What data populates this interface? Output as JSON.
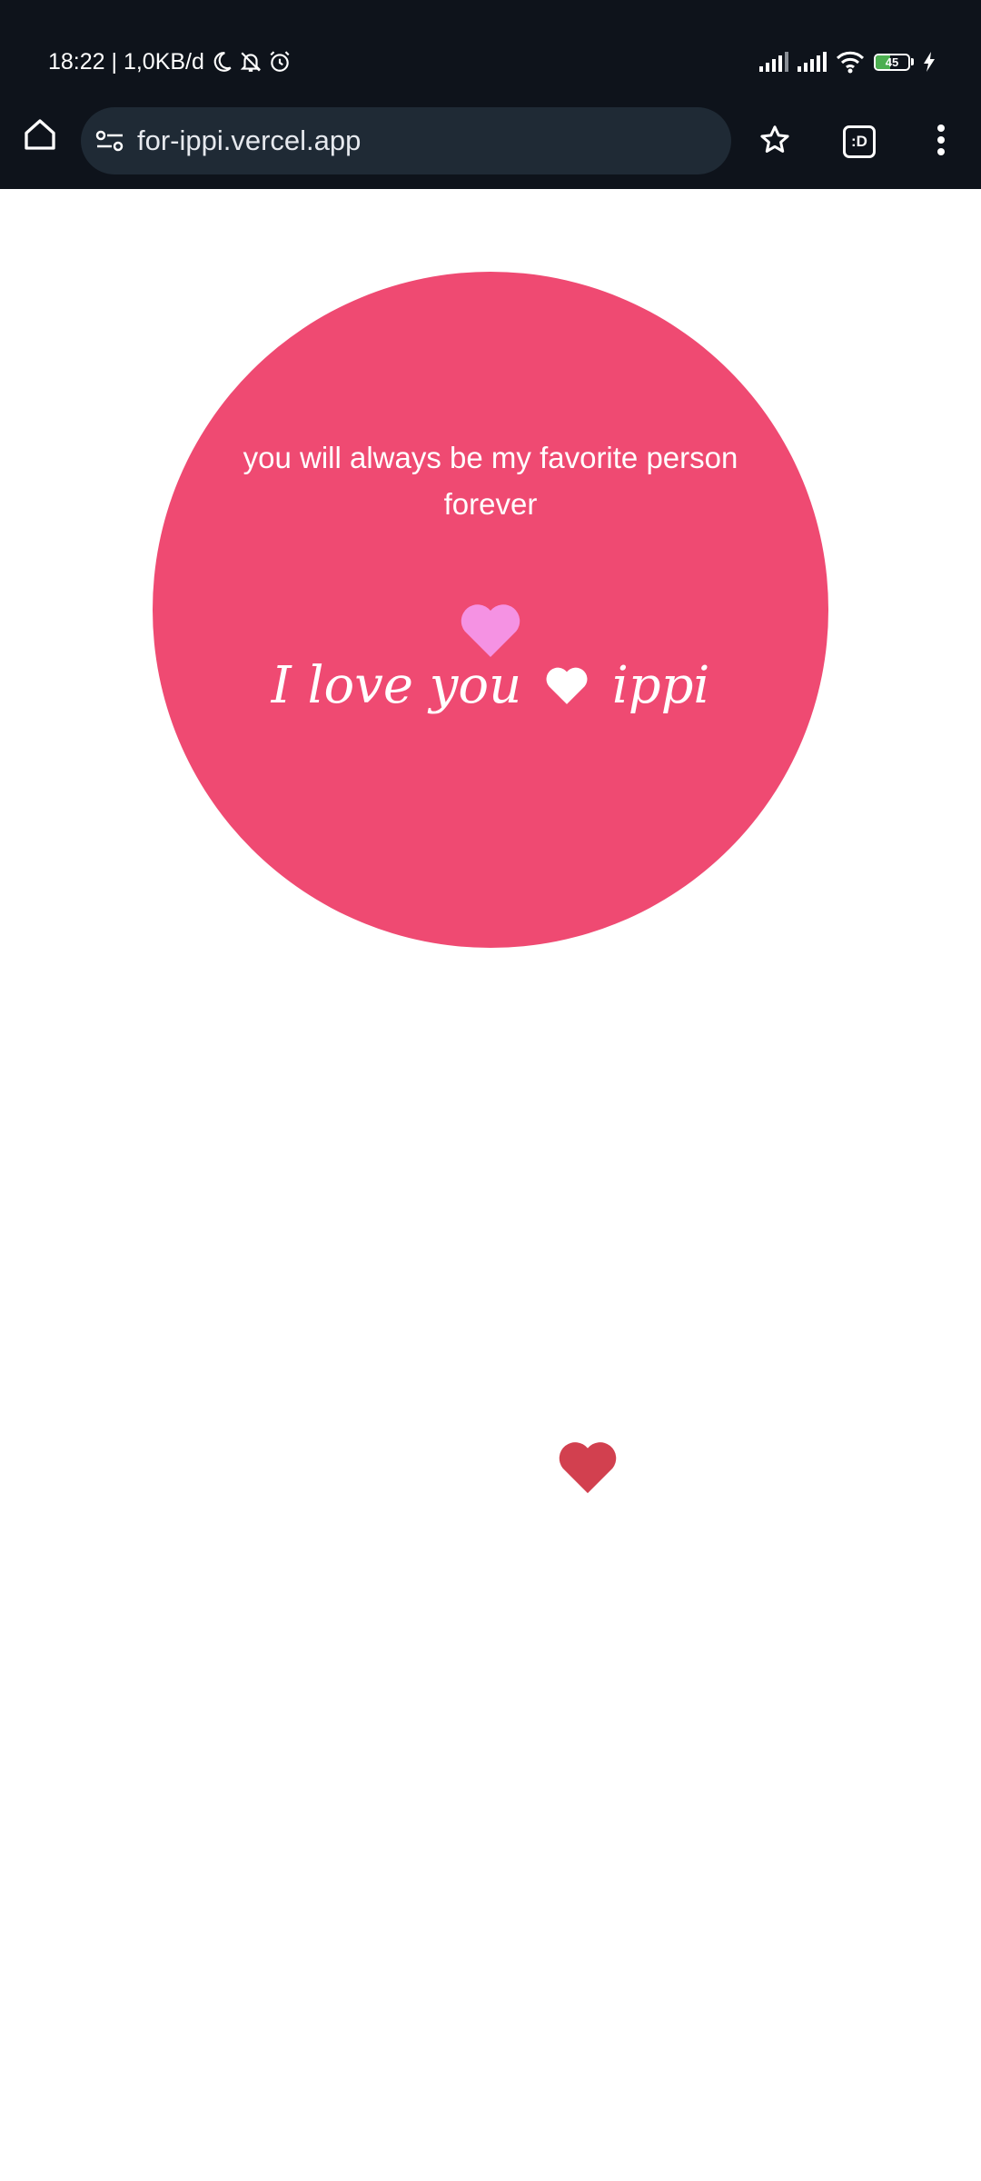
{
  "status_bar": {
    "time_speed": "18:22 | 1,0KB/d",
    "battery_level": "45",
    "battery_fraction": 0.45,
    "icons": [
      "moon-icon",
      "bell-off-icon",
      "alarm-icon",
      "signal-icon",
      "signal-icon",
      "wifi-icon",
      "battery-icon",
      "charging-icon"
    ]
  },
  "toolbar": {
    "url": "for-ippi.vercel.app",
    "tabs_label": ":D",
    "icons": [
      "home-icon",
      "site-settings-icon",
      "bookmark-star-icon",
      "tab-switcher-icon",
      "more-vert-icon"
    ]
  },
  "page": {
    "message": "you will always be my favorite person forever",
    "love_prefix": "I love you",
    "love_suffix": "ippi",
    "colors": {
      "circle": "#ef4a72",
      "pink_heart": "#f592e3",
      "red_heart": "#d2404f",
      "text": "#ffffff"
    }
  }
}
